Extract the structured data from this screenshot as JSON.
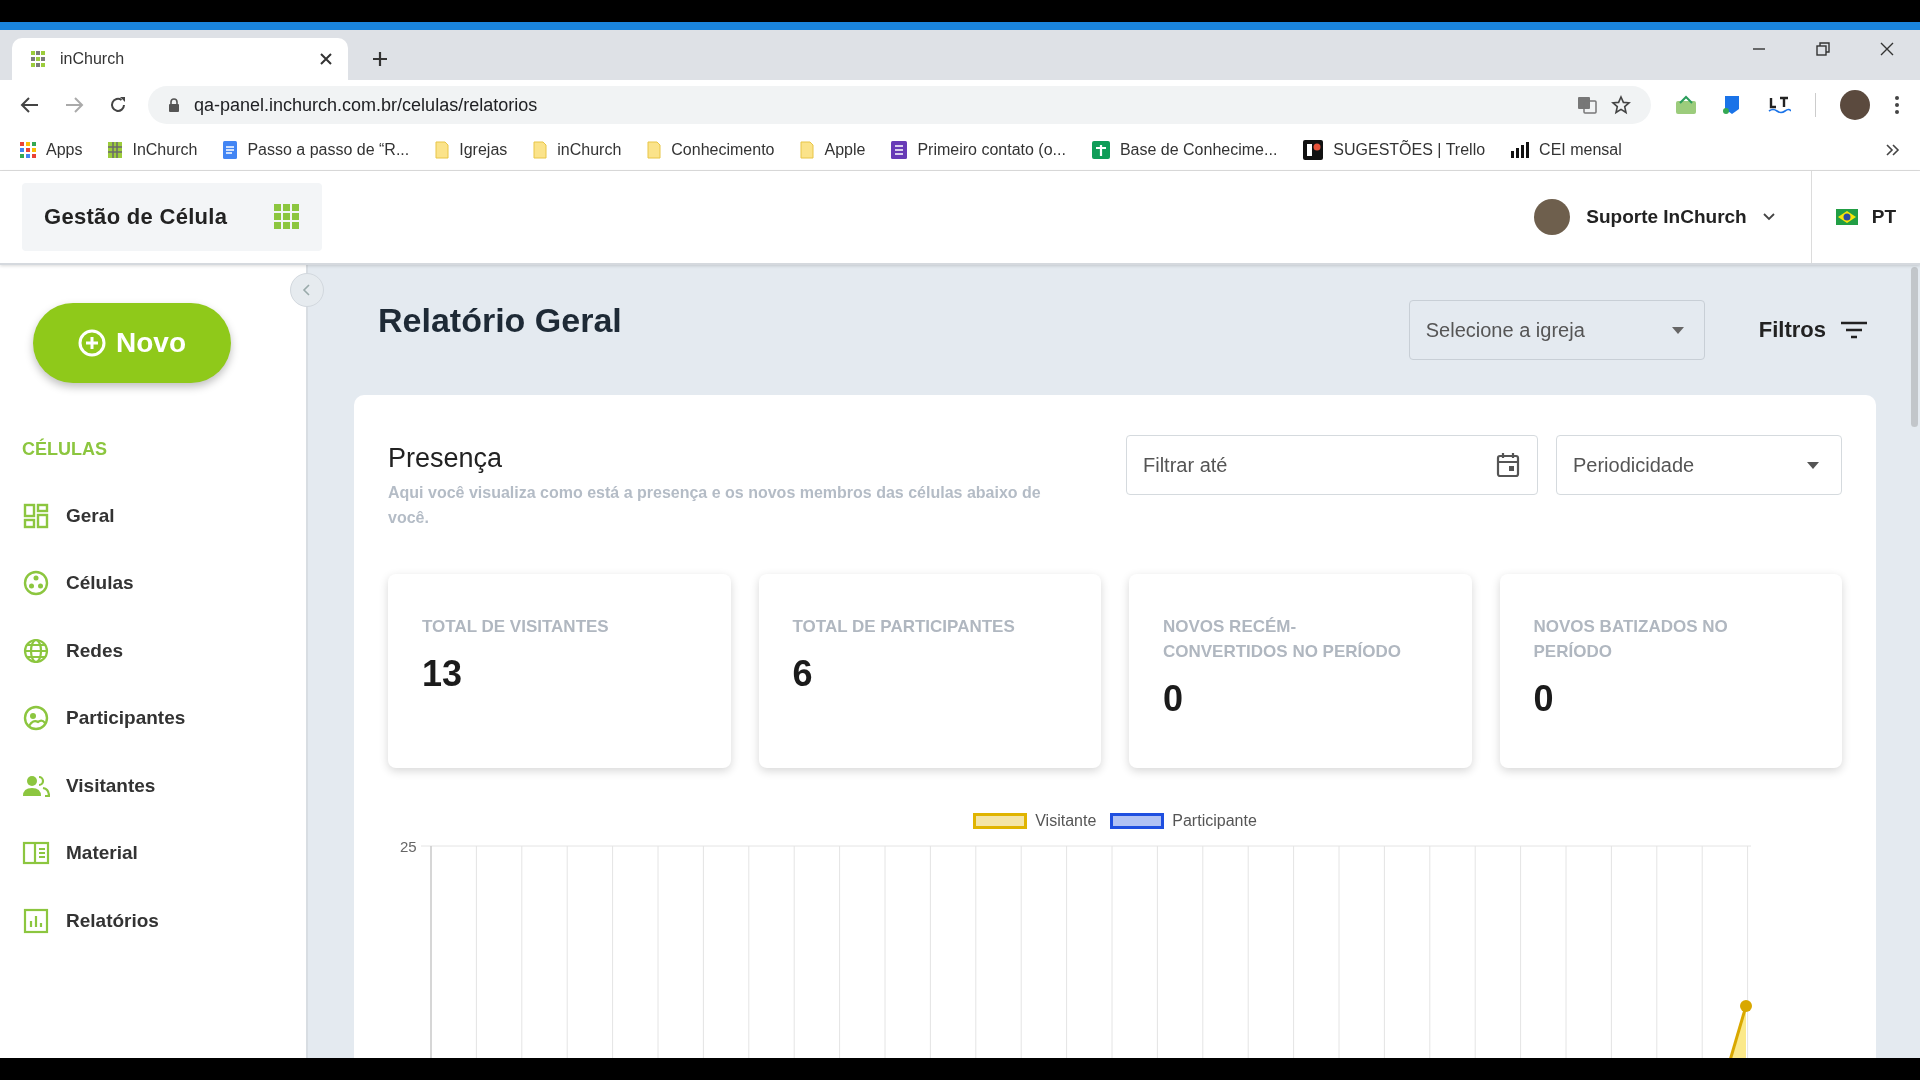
{
  "browser": {
    "tabs": [
      {
        "title": "inChurch",
        "selected": true
      }
    ],
    "url": "qa-panel.inchurch.com.br/celulas/relatorios",
    "bookmarks": [
      {
        "label": "Apps",
        "kind": "apps"
      },
      {
        "label": "InChurch",
        "kind": "site"
      },
      {
        "label": "Passo a passo de “R...",
        "kind": "doc"
      },
      {
        "label": "Igrejas",
        "kind": "folder"
      },
      {
        "label": "inChurch",
        "kind": "folder"
      },
      {
        "label": "Conhecimento",
        "kind": "folder"
      },
      {
        "label": "Apple",
        "kind": "folder"
      },
      {
        "label": "Primeiro contato (o...",
        "kind": "form"
      },
      {
        "label": "Base de Conhecime...",
        "kind": "sheet"
      },
      {
        "label": "SUGESTÕES | Trello",
        "kind": "trello"
      },
      {
        "label": "CEI mensal",
        "kind": "bars"
      }
    ]
  },
  "header": {
    "app_title": "Gestão de Célula",
    "user": "Suporte InChurch",
    "language": "PT"
  },
  "sidebar": {
    "new_button": "Novo",
    "section": "CÉLULAS",
    "items": [
      {
        "label": "Geral"
      },
      {
        "label": "Células"
      },
      {
        "label": "Redes"
      },
      {
        "label": "Participantes"
      },
      {
        "label": "Visitantes"
      },
      {
        "label": "Material"
      },
      {
        "label": "Relatórios"
      }
    ]
  },
  "page": {
    "title": "Relatório Geral",
    "church_select": {
      "placeholder": "Selecione a igreja"
    },
    "filters": "Filtros",
    "presence": {
      "title": "Presença",
      "description": "Aqui você visualiza como está a presença e os novos membros das células abaixo de você.",
      "date_field": {
        "placeholder": "Filtrar até"
      },
      "period_select": {
        "placeholder": "Periodicidade"
      },
      "stats": [
        {
          "label": "TOTAL DE VISITANTES",
          "value": "13"
        },
        {
          "label": "TOTAL DE PARTICIPANTES",
          "value": "6"
        },
        {
          "label": "NOVOS RECÉM-CONVERTIDOS NO PERÍODO",
          "value": "0"
        },
        {
          "label": "NOVOS BATIZADOS NO PERÍODO",
          "value": "0"
        }
      ],
      "chart": {
        "legend": [
          {
            "name": "Visitante",
            "color": "#e0b400"
          },
          {
            "name": "Participante",
            "color": "#1f4fe0"
          }
        ],
        "y_tick": "25"
      }
    }
  }
}
